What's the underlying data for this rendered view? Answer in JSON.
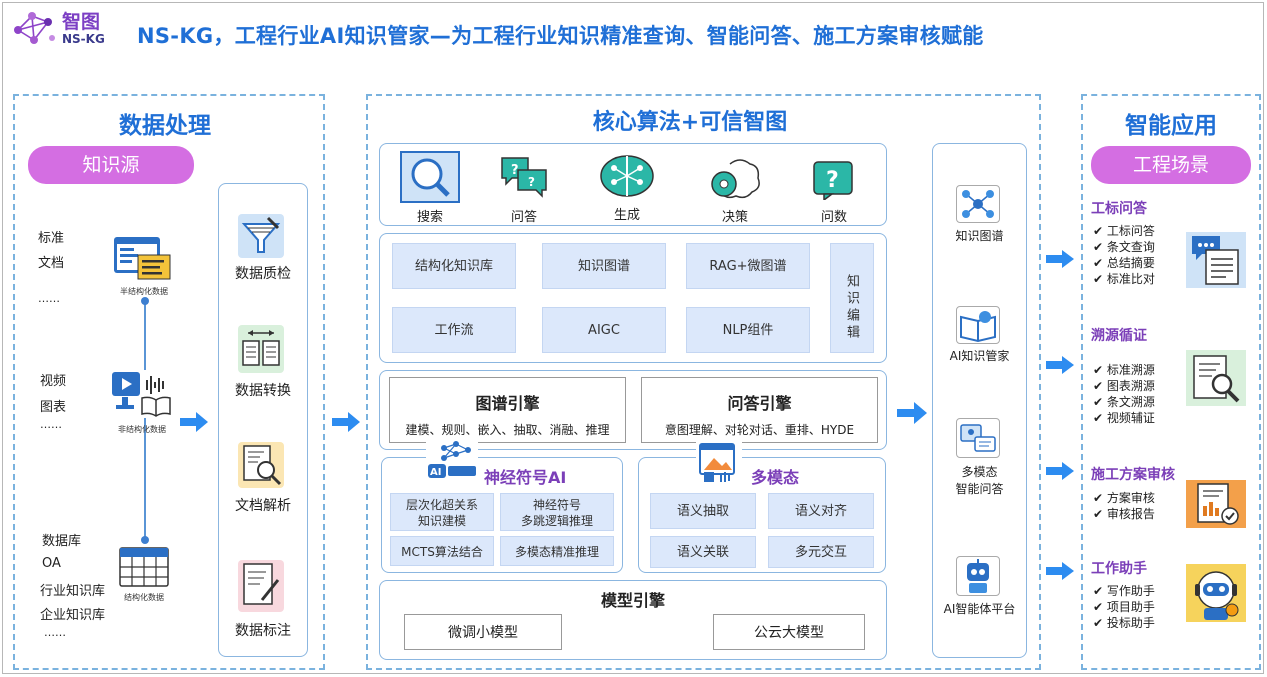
{
  "header": {
    "logo_text": "智图",
    "logo_sub": "NS-KG",
    "title": "NS-KG，工程行业AI知识管家—为工程行业知识精准查询、智能问答、施工方案审核赋能"
  },
  "data_processing": {
    "title": "数据处理",
    "source_pill": "知识源",
    "sources": {
      "semi_structured": [
        "标准",
        "文档",
        "……"
      ],
      "semi_label": "半结构化数据",
      "unstructured": [
        "视频",
        "图表",
        "……"
      ],
      "unstructured_label": "非结构化数据",
      "structured": [
        "数据库",
        "OA",
        "行业知识库",
        "企业知识库",
        "……"
      ],
      "structured_label": "结构化数据"
    },
    "steps": [
      "数据质检",
      "数据转换",
      "文档解析",
      "数据标注"
    ]
  },
  "core": {
    "title": "核心算法+可信智图",
    "capabilities": [
      "搜索",
      "问答",
      "生成",
      "决策",
      "问数"
    ],
    "modules": [
      "结构化知识库",
      "知识图谱",
      "RAG+微图谱",
      "工作流",
      "AIGC",
      "NLP组件"
    ],
    "knowledge_edit": "知识编辑",
    "graph_engine": {
      "title": "图谱引擎",
      "desc": "建模、规则、嵌入、抽取、消融、推理"
    },
    "qa_engine": {
      "title": "问答引擎",
      "desc": "意图理解、对轮对话、重排、HYDE"
    },
    "neuro_symbolic": {
      "title": "神经符号AI",
      "items": [
        "层次化超关系",
        "知识建模",
        "神经符号",
        "多跳逻辑推理",
        "MCTS算法结合",
        "多模态精准推理"
      ]
    },
    "multimodal": {
      "title": "多模态",
      "items": [
        "语义抽取",
        "语义对齐",
        "语义关联",
        "多元交互"
      ]
    },
    "model_engine": {
      "title": "模型引擎",
      "items": [
        "微调小模型",
        "公云大模型"
      ]
    }
  },
  "platforms": [
    "知识图谱",
    "AI知识管家",
    "多模态",
    "智能问答",
    "AI智能体平台"
  ],
  "applications": {
    "title": "智能应用",
    "scene_pill": "工程场景",
    "groups": [
      {
        "title": "工标问答",
        "items": [
          "工标问答",
          "条文查询",
          "总结摘要",
          "标准比对"
        ]
      },
      {
        "title": "溯源循证",
        "items": [
          "标准溯源",
          "图表溯源",
          "条文溯源",
          "视频辅证"
        ]
      },
      {
        "title": "施工方案审核",
        "items": [
          "方案审核",
          "审核报告"
        ]
      },
      {
        "title": "工作助手",
        "items": [
          "写作助手",
          "项目助手",
          "投标助手"
        ]
      }
    ]
  },
  "check_mark": "✔",
  "colors": {
    "accent": "#1f6fd6",
    "purple": "#d46ee2",
    "box_fill": "#dce8fb",
    "arrow": "#2d8cf0"
  }
}
